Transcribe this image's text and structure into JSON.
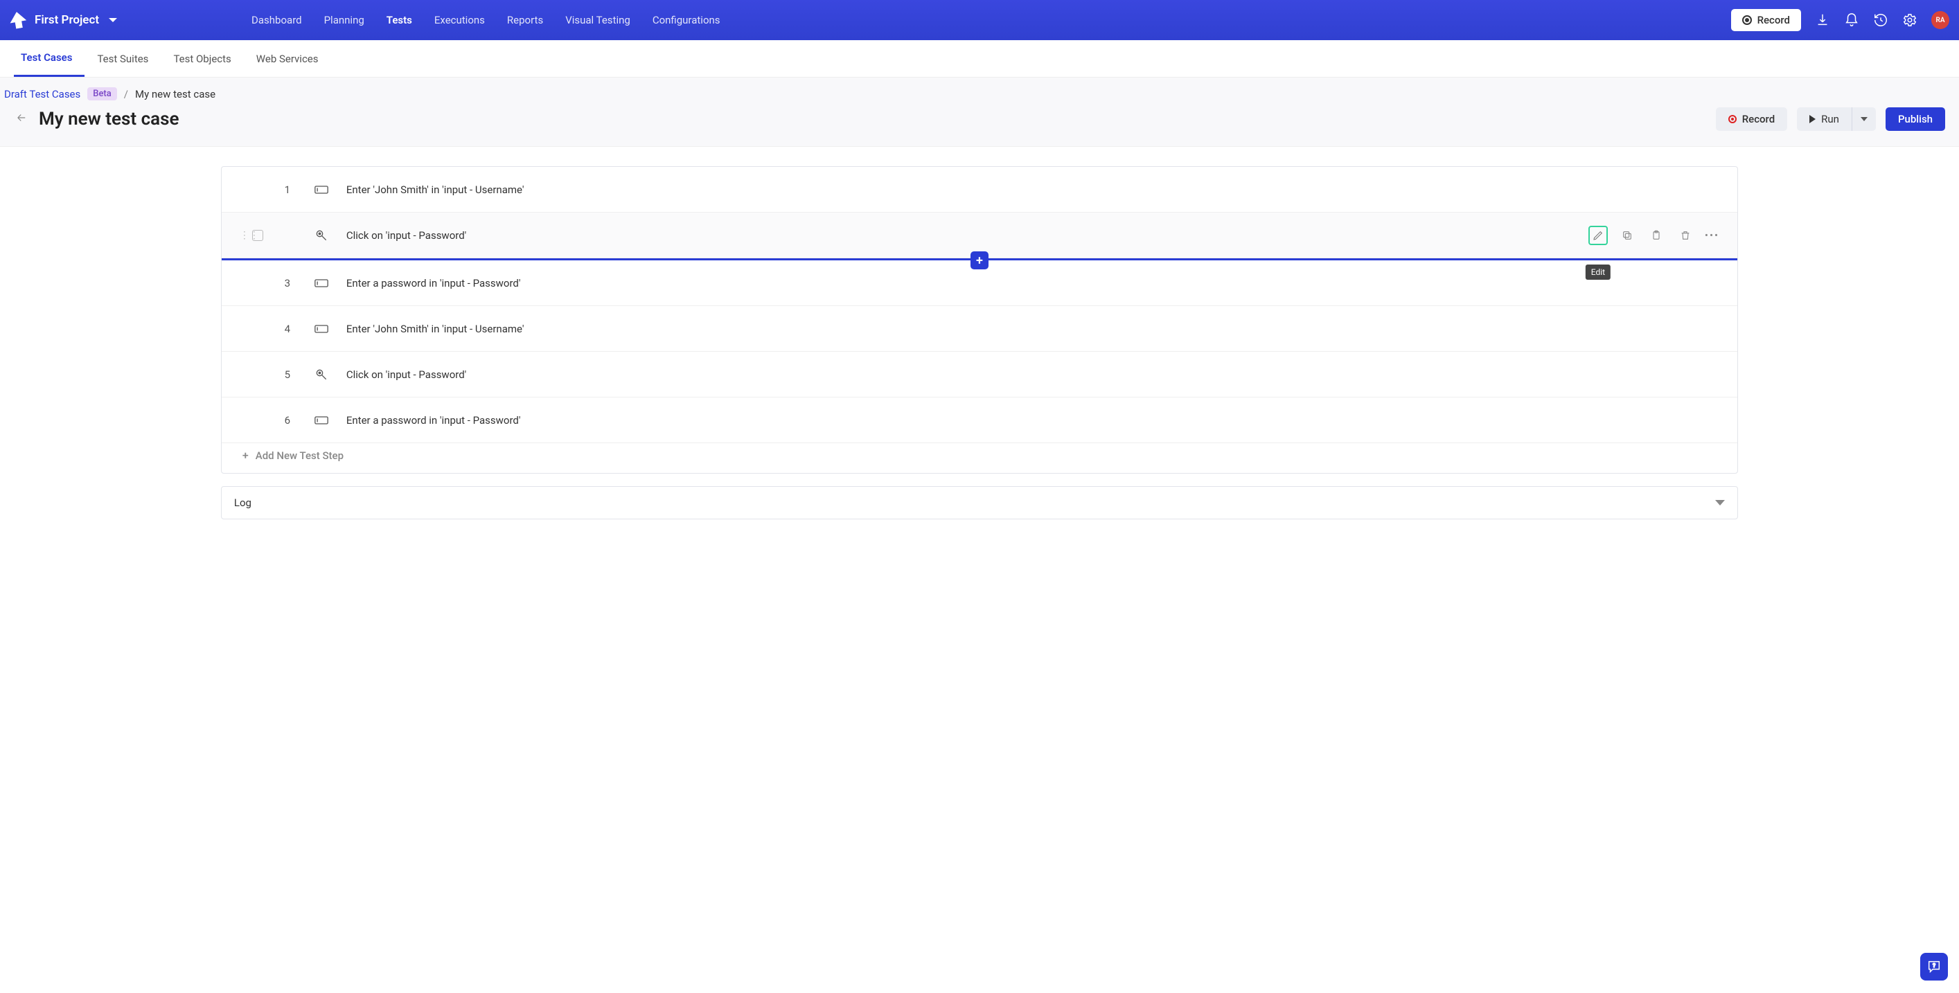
{
  "project_name": "First Project",
  "avatar_initials": "RA",
  "nav": {
    "items": [
      "Dashboard",
      "Planning",
      "Tests",
      "Executions",
      "Reports",
      "Visual Testing",
      "Configurations"
    ],
    "active_index": 2
  },
  "top_record_label": "Record",
  "subtabs": {
    "items": [
      "Test Cases",
      "Test Suites",
      "Test Objects",
      "Web Services"
    ],
    "active_index": 0
  },
  "breadcrumb": {
    "draft_label": "Draft Test Cases",
    "beta_badge": "Beta",
    "current": "My new test case"
  },
  "page_title": "My new test case",
  "actions": {
    "record": "Record",
    "run": "Run",
    "publish": "Publish"
  },
  "tooltip_edit": "Edit",
  "add_step_label": "Add New Test Step",
  "log_label": "Log",
  "steps": [
    {
      "num": "1",
      "icon": "input",
      "text": "Enter 'John Smith' in 'input - Username'"
    },
    {
      "num": "",
      "icon": "click",
      "text": "Click on 'input - Password'",
      "hovered": true,
      "show_actions": true,
      "insert_after": true
    },
    {
      "num": "3",
      "icon": "input",
      "text": "Enter a password in 'input - Password'"
    },
    {
      "num": "4",
      "icon": "input",
      "text": "Enter 'John Smith' in 'input - Username'"
    },
    {
      "num": "5",
      "icon": "click",
      "text": "Click on 'input - Password'"
    },
    {
      "num": "6",
      "icon": "input",
      "text": "Enter a password in 'input - Password'"
    }
  ]
}
